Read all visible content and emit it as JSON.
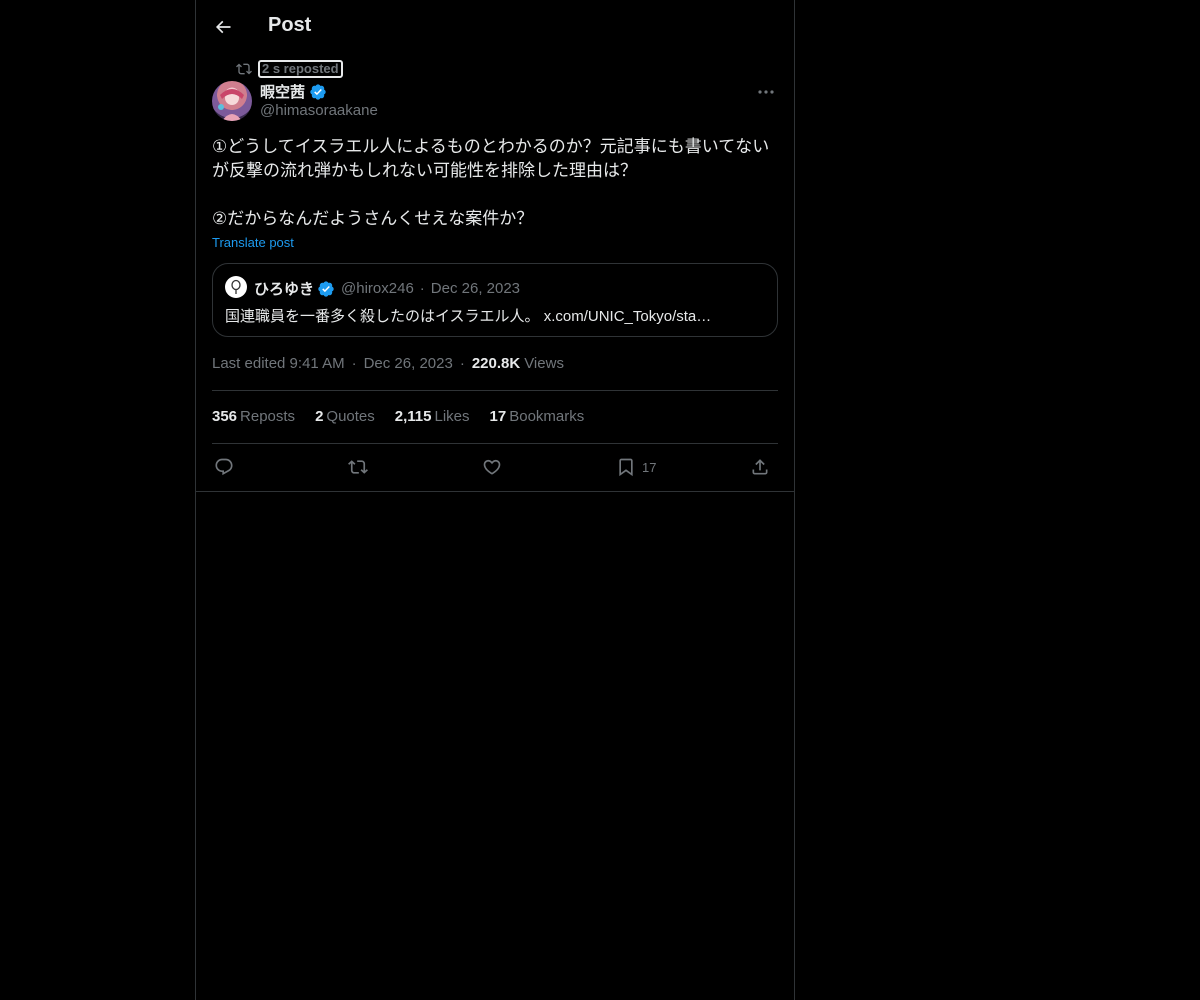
{
  "header": {
    "title": "Post"
  },
  "repost": {
    "text": "2 s reposted"
  },
  "author": {
    "name": "暇空茜",
    "handle": "@himasoraakane"
  },
  "post": {
    "text": "①どうしてイスラエル人によるものとわかるのか？元記事にも書いてないが反撃の流れ弾かもしれない可能性を排除した理由は？\n\n②だからなんだようさんくせえな案件か？",
    "translate_label": "Translate post"
  },
  "quote": {
    "name": "ひろゆき",
    "handle": "@hirox246",
    "separator": "·",
    "date": "Dec 26, 2023",
    "text": "国連職員を一番多く殺したのはイスラエル人。 x.com/UNIC_Tokyo/sta…"
  },
  "meta": {
    "edited": "Last edited 9:41 AM",
    "separator": "·",
    "date": "Dec 26, 2023",
    "views_count": "220.8K",
    "views_label": "Views"
  },
  "stats": {
    "reposts_count": "356",
    "reposts_label": "Reposts",
    "quotes_count": "2",
    "quotes_label": "Quotes",
    "likes_count": "2,115",
    "likes_label": "Likes",
    "bookmarks_count": "17",
    "bookmarks_label": "Bookmarks"
  },
  "actions": {
    "bookmark_count": "17"
  },
  "icons": {
    "back": "arrow-left-icon",
    "repost": "repost-icon",
    "verified": "verified-badge-icon",
    "more": "more-icon",
    "reply": "reply-icon",
    "like": "heart-icon",
    "bookmark": "bookmark-icon",
    "share": "share-icon"
  },
  "colors": {
    "background": "#000000",
    "text": "#e7e9ea",
    "muted": "#71767b",
    "accent": "#1d9bf0",
    "border": "#2f3336"
  }
}
